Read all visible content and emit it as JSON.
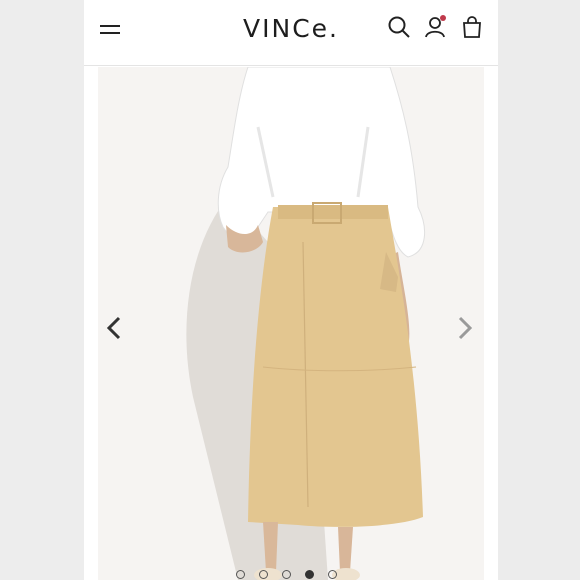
{
  "brand": {
    "logo_text": "VINCe."
  },
  "header": {
    "menu_icon": "hamburger-menu-icon",
    "search_icon": "search-icon",
    "account_icon": "user-icon",
    "bag_icon": "shopping-bag-icon",
    "notification_color": "#c0394b"
  },
  "gallery": {
    "prev_icon": "chevron-left-icon",
    "next_icon": "chevron-right-icon",
    "slide_count": 5,
    "active_slide": 4
  },
  "colors": {
    "skirt": "#e3c690",
    "shirt": "#ffffff",
    "background": "#f6f4f2"
  }
}
